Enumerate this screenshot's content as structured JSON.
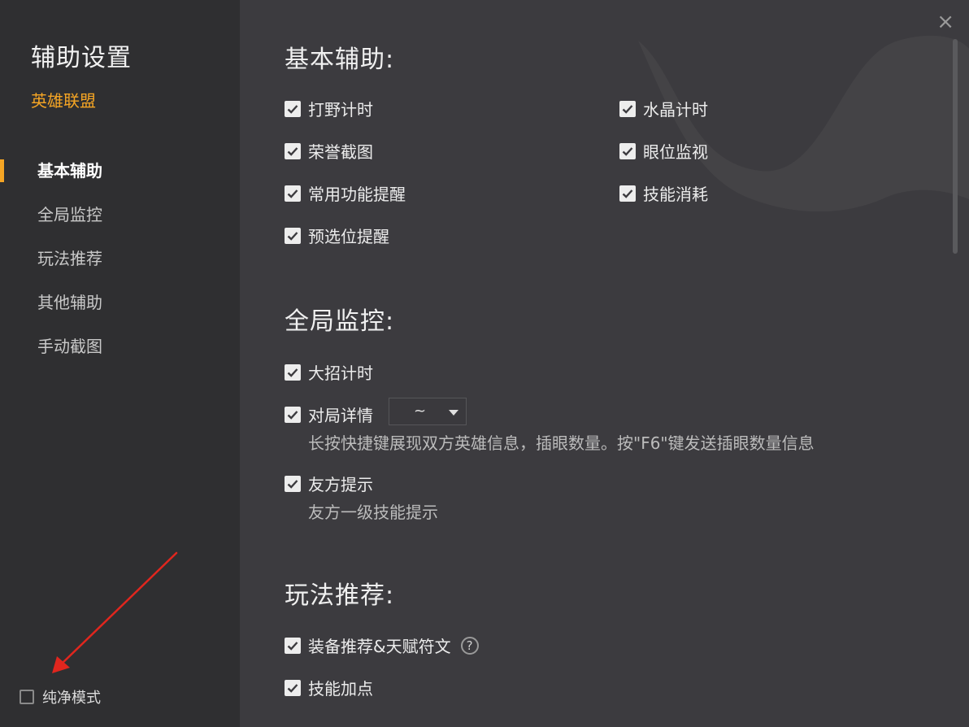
{
  "sidebar": {
    "title": "辅助设置",
    "subtitle": "英雄联盟",
    "items": [
      {
        "label": "基本辅助"
      },
      {
        "label": "全局监控"
      },
      {
        "label": "玩法推荐"
      },
      {
        "label": "其他辅助"
      },
      {
        "label": "手动截图"
      }
    ],
    "pure_mode": {
      "label": "纯净模式",
      "checked": false
    }
  },
  "colors": {
    "accent": "#f5a524",
    "annotation_arrow": "#e0261e"
  },
  "close_icon": "×",
  "sections": {
    "basic": {
      "title": "基本辅助:",
      "options": [
        {
          "label": "打野计时",
          "checked": true
        },
        {
          "label": "水晶计时",
          "checked": true
        },
        {
          "label": "荣誉截图",
          "checked": true
        },
        {
          "label": "眼位监视",
          "checked": true
        },
        {
          "label": "常用功能提醒",
          "checked": true
        },
        {
          "label": "技能消耗",
          "checked": true
        },
        {
          "label": "预选位提醒",
          "checked": true
        }
      ]
    },
    "global": {
      "title": "全局监控:",
      "ult_timer": {
        "label": "大招计时",
        "checked": true
      },
      "match_details": {
        "label": "对局详情",
        "checked": true,
        "hotkey": "~",
        "desc": "长按快捷键展现双方英雄信息，插眼数量。按\"F6\"键发送插眼数量信息"
      },
      "ally_hint": {
        "label": "友方提示",
        "checked": true,
        "desc": "友方一级技能提示"
      }
    },
    "recommend": {
      "title": "玩法推荐:",
      "equip": {
        "label": "装备推荐&天赋符文",
        "checked": true,
        "help": "?"
      },
      "skill": {
        "label": "技能加点",
        "checked": true
      }
    }
  }
}
